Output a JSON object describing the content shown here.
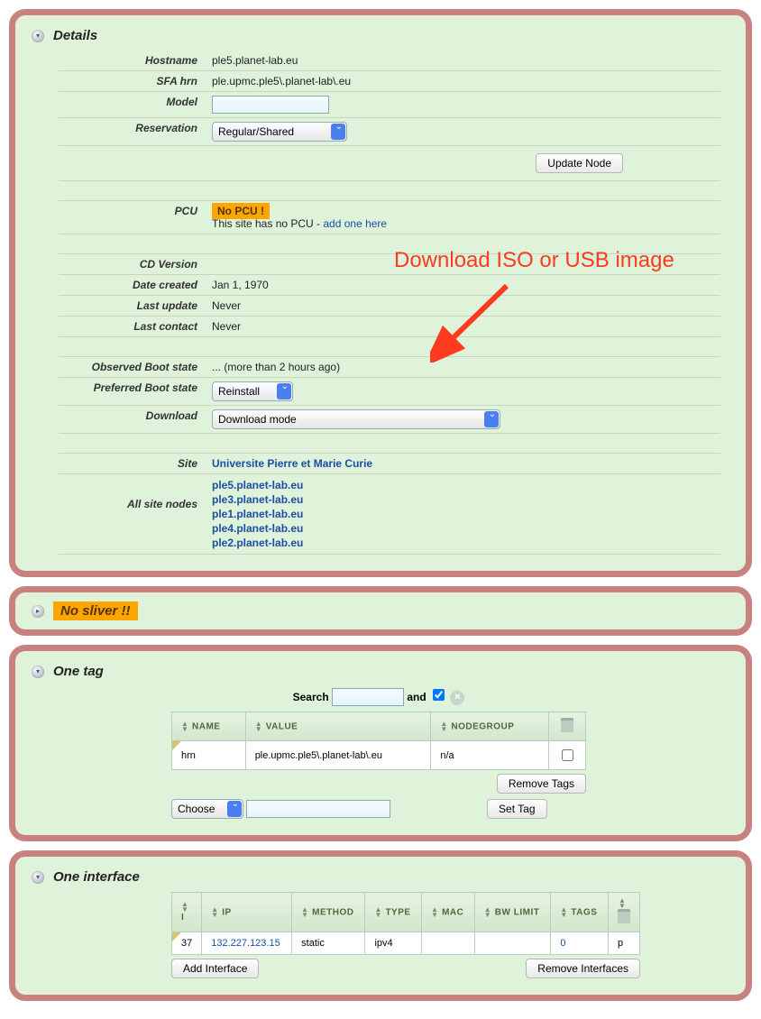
{
  "details": {
    "title": "Details",
    "hostname_label": "Hostname",
    "hostname": "ple5.planet-lab.eu",
    "sfa_label": "SFA hrn",
    "sfa": "ple.upmc.ple5\\.planet-lab\\.eu",
    "model_label": "Model",
    "model": "",
    "reservation_label": "Reservation",
    "reservation": "Regular/Shared",
    "update_btn": "Update Node",
    "pcu_label": "PCU",
    "pcu_badge": "No PCU !",
    "pcu_text": "This site has no PCU - ",
    "pcu_link": "add one here",
    "cdversion_label": "CD Version",
    "datecreated_label": "Date created",
    "datecreated": "Jan 1, 1970",
    "lastupdate_label": "Last update",
    "lastupdate": "Never",
    "lastcontact_label": "Last contact",
    "lastcontact": "Never",
    "obs_label": "Observed Boot state",
    "obs": "... (more than 2 hours ago)",
    "pref_label": "Preferred Boot state",
    "pref": "Reinstall",
    "download_label": "Download",
    "download": "Download mode",
    "site_label": "Site",
    "site": "Universite Pierre et Marie Curie",
    "allnodes_label": "All site nodes",
    "nodes": [
      "ple5.planet-lab.eu",
      "ple3.planet-lab.eu",
      "ple1.planet-lab.eu",
      "ple4.planet-lab.eu",
      "ple2.planet-lab.eu"
    ]
  },
  "sliver": {
    "title": "No sliver !!"
  },
  "tags": {
    "title": "One tag",
    "search_label": "Search",
    "and_label": "and",
    "col_name": "NAME",
    "col_value": "VALUE",
    "col_group": "NODEGROUP",
    "row": {
      "name": "hrn",
      "value": "ple.upmc.ple5\\.planet-lab\\.eu",
      "group": "n/a"
    },
    "remove_btn": "Remove Tags",
    "choose": "Choose",
    "set_btn": "Set Tag"
  },
  "iface": {
    "title": "One interface",
    "col_i": "I",
    "col_ip": "IP",
    "col_method": "METHOD",
    "col_type": "TYPE",
    "col_mac": "MAC",
    "col_bw": "BW LIMIT",
    "col_tags": "TAGS",
    "row": {
      "i": "37",
      "ip": "132.227.123.15",
      "method": "static",
      "type": "ipv4",
      "mac": "",
      "bw": "",
      "tags": "0",
      "p": "p"
    },
    "add_btn": "Add Interface",
    "remove_btn": "Remove Interfaces"
  },
  "annotation": "Download ISO or USB image"
}
